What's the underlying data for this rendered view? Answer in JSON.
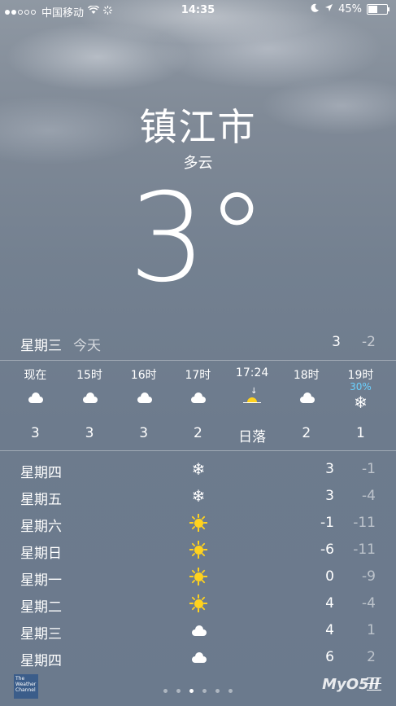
{
  "status_bar": {
    "carrier": "中国移动",
    "time": "14:35",
    "battery": "45%"
  },
  "city": "镇江市",
  "condition": "多云",
  "current_temp": "3",
  "today": {
    "day": "星期三",
    "label": "今天",
    "high": "3",
    "low": "-2"
  },
  "hourly": [
    {
      "time": "现在",
      "icon": "cloud-icon",
      "value": "3"
    },
    {
      "time": "15时",
      "icon": "cloud-icon",
      "value": "3"
    },
    {
      "time": "16时",
      "icon": "cloud-icon",
      "value": "3"
    },
    {
      "time": "17时",
      "icon": "cloud-icon",
      "value": "2"
    },
    {
      "time": "17:24",
      "icon": "sunset-icon",
      "value": "日落"
    },
    {
      "time": "18时",
      "icon": "cloud-icon",
      "value": "2"
    },
    {
      "time": "19时",
      "icon": "snow-icon",
      "value": "1",
      "precip": "30%"
    }
  ],
  "daily": [
    {
      "day": "星期四",
      "icon": "snow-icon",
      "high": "3",
      "low": "-1"
    },
    {
      "day": "星期五",
      "icon": "snow-icon",
      "high": "3",
      "low": "-4"
    },
    {
      "day": "星期六",
      "icon": "sun-icon",
      "high": "-1",
      "low": "-11"
    },
    {
      "day": "星期日",
      "icon": "sun-icon",
      "high": "-6",
      "low": "-11"
    },
    {
      "day": "星期一",
      "icon": "sun-icon",
      "high": "0",
      "low": "-9"
    },
    {
      "day": "星期二",
      "icon": "sun-icon",
      "high": "4",
      "low": "-4"
    },
    {
      "day": "星期三",
      "icon": "cloud-icon",
      "high": "4",
      "low": "1"
    },
    {
      "day": "星期四",
      "icon": "cloud-icon",
      "high": "6",
      "low": "2"
    }
  ],
  "footer": {
    "weather_channel": "The Weather Channel",
    "watermark": "MyO5II"
  },
  "colors": {
    "sun": "#ffd21e",
    "precip": "#6ad0ff"
  }
}
